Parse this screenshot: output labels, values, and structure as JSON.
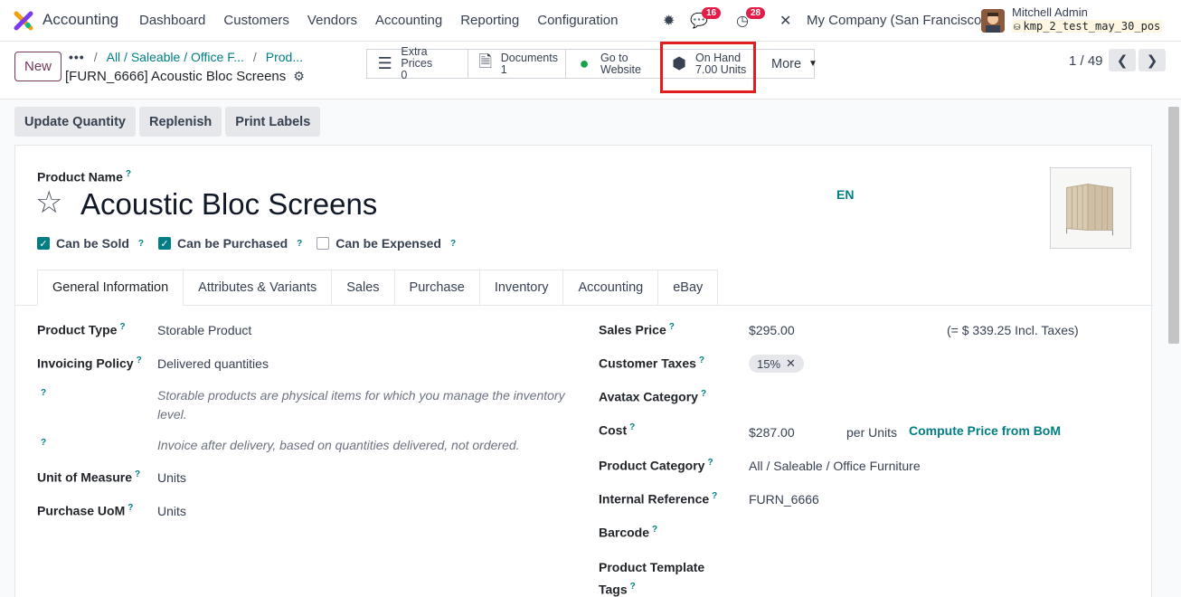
{
  "app": {
    "name": "Accounting"
  },
  "menu": [
    "Dashboard",
    "Customers",
    "Vendors",
    "Accounting",
    "Reporting",
    "Configuration"
  ],
  "system": {
    "messages_count": "16",
    "activities_count": "28",
    "company": "My Company (San Francisco)"
  },
  "user": {
    "name": "Mitchell Admin",
    "database": "kmp_2_test_may_30_pos"
  },
  "control": {
    "new_label": "New",
    "breadcrumb": [
      "All / Saleable / Office F...",
      "Prod..."
    ],
    "record_title": "[FURN_6666] Acoustic Bloc Screens",
    "smart_buttons": [
      {
        "label": "Extra Prices",
        "value": "0",
        "icon": "list-icon"
      },
      {
        "label": "Documents",
        "value": "1",
        "icon": "document-icon"
      },
      {
        "label": "Go to",
        "value": "Website",
        "icon": "globe-icon"
      },
      {
        "label": "On Hand",
        "value": "7.00 Units",
        "icon": "cubes-icon"
      }
    ],
    "more_label": "More",
    "pager": "1 / 49"
  },
  "actions": [
    "Update Quantity",
    "Replenish",
    "Print Labels"
  ],
  "form": {
    "name_label": "Product Name",
    "product_name": "Acoustic Bloc Screens",
    "lang": "EN",
    "checks": [
      {
        "label": "Can be Sold",
        "checked": true
      },
      {
        "label": "Can be Purchased",
        "checked": true
      },
      {
        "label": "Can be Expensed",
        "checked": false
      }
    ],
    "tabs": [
      "General Information",
      "Attributes & Variants",
      "Sales",
      "Purchase",
      "Inventory",
      "Accounting",
      "eBay"
    ],
    "left": {
      "product_type_label": "Product Type",
      "product_type": "Storable Product",
      "invoicing_label": "Invoicing Policy",
      "invoicing": "Delivered quantities",
      "hint1": "Storable products are physical items for which you manage the inventory level.",
      "hint2": "Invoice after delivery, based on quantities delivered, not ordered.",
      "uom_label": "Unit of Measure",
      "uom": "Units",
      "puom_label": "Purchase UoM",
      "puom": "Units"
    },
    "right": {
      "sales_price_label": "Sales Price",
      "sales_price": "$295.00",
      "incl_taxes": "(= $ 339.25 Incl. Taxes)",
      "customer_taxes_label": "Customer Taxes",
      "customer_tax": "15%",
      "avatax_label": "Avatax Category",
      "cost_label": "Cost",
      "cost": "$287.00",
      "per_unit": "per Units",
      "compute_link": "Compute Price from BoM",
      "category_label": "Product Category",
      "category": "All / Saleable / Office Furniture",
      "ref_label": "Internal Reference",
      "ref": "FURN_6666",
      "barcode_label": "Barcode",
      "template_tags_label_1": "Product Template",
      "template_tags_label_2": "Tags"
    }
  }
}
